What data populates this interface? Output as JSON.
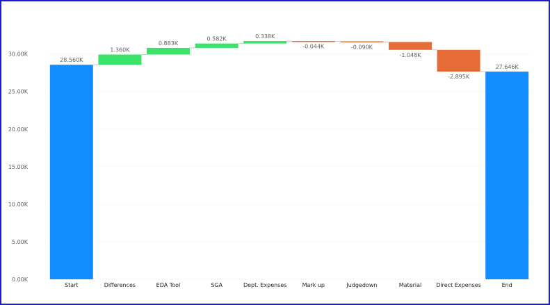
{
  "chart_data": {
    "type": "waterfall",
    "title": "",
    "xlabel": "",
    "ylabel": "",
    "ylim": [
      0,
      30000
    ],
    "yticks": [
      0,
      5000,
      10000,
      15000,
      20000,
      25000,
      30000
    ],
    "ytick_labels": [
      "0.00K",
      "5.00K",
      "10.00K",
      "15.00K",
      "20.00K",
      "25.00K",
      "30.00K"
    ],
    "grid": true,
    "categories": [
      "Start",
      "Differences",
      "EDA Tool",
      "SGA",
      "Dept. Expenses",
      "Mark up",
      "Judgedown",
      "Material",
      "Direct Expenses",
      "End"
    ],
    "values": [
      28560,
      1360,
      883,
      582,
      338,
      -44,
      -90,
      -1048,
      -2895,
      27646
    ],
    "kinds": [
      "total",
      "delta",
      "delta",
      "delta",
      "delta",
      "delta",
      "delta",
      "delta",
      "delta",
      "total"
    ],
    "data_labels": [
      "28.560K",
      "1.360K",
      "0.883K",
      "0.582K",
      "0.338K",
      "-0.044K",
      "-0.090K",
      "-1.048K",
      "-2.895K",
      "27.646K"
    ],
    "colors": {
      "total": "#118DFF",
      "increase": "#3BE369",
      "decrease": "#E66C37",
      "connector": "#c8c6c4",
      "grid": "#e6e6e6"
    }
  }
}
